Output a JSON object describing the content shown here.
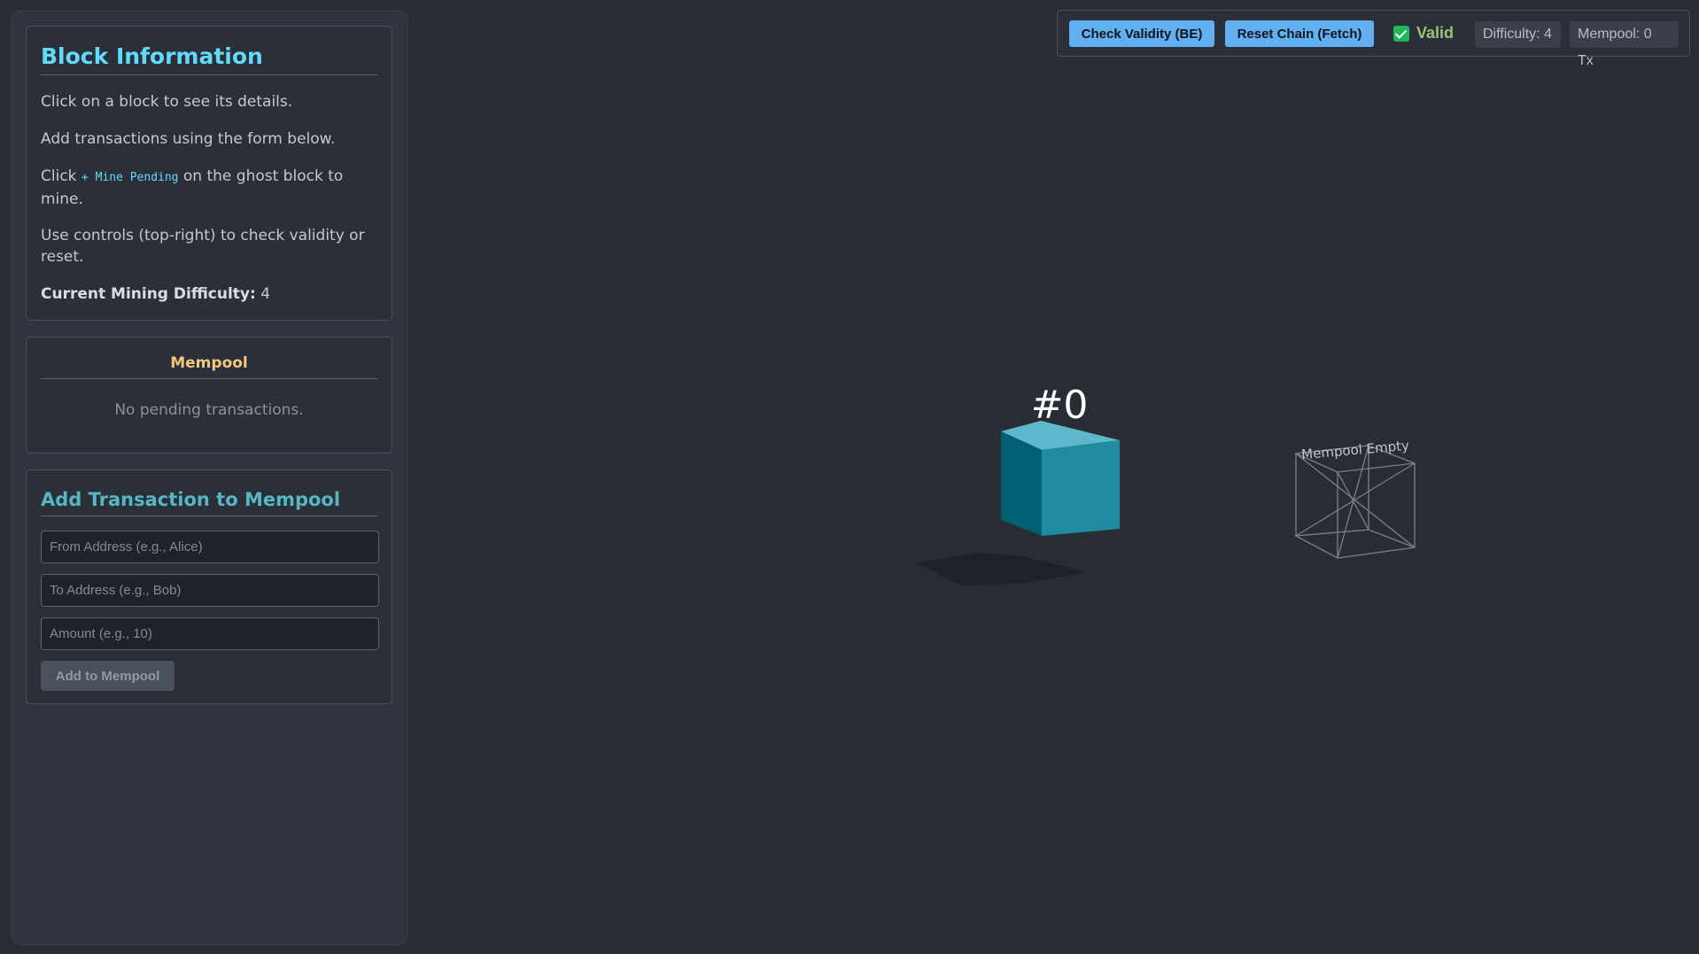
{
  "sidebar": {
    "info": {
      "title": "Block Information",
      "line1": "Click on a block to see its details.",
      "line2": "Add transactions using the form below.",
      "line3_pre": "Click ",
      "line3_code": "+ Mine Pending",
      "line3_post": " on the ghost block to mine.",
      "line4": "Use controls (top-right) to check validity or reset.",
      "difficulty_label": "Current Mining Difficulty:",
      "difficulty_value": " 4"
    },
    "mempool": {
      "title": "Mempool",
      "empty_text": "No pending transactions."
    },
    "add_tx": {
      "title": "Add Transaction to Mempool",
      "from_placeholder": "From Address (e.g., Alice)",
      "to_placeholder": "To Address (e.g., Bob)",
      "amount_placeholder": "Amount (e.g., 10)",
      "from_value": "",
      "to_value": "",
      "amount_value": "",
      "submit_label": "Add to Mempool"
    }
  },
  "controls": {
    "check_label": "Check Validity (BE)",
    "reset_label": "Reset Chain (Fetch)",
    "valid_checked": true,
    "valid_label": "Valid",
    "difficulty_text": "Difficulty: 4",
    "mempool_text": "Mempool: 0 Tx"
  },
  "scene": {
    "block_label": "#0",
    "ghost_label": "Mempool Empty",
    "colors": {
      "block_top": "#5db8cc",
      "block_front": "#218aa1",
      "block_side": "#006073",
      "ghost_edges": "#7a808a",
      "accent": "#61dafb",
      "valid": "#98c379"
    }
  },
  "icons": {
    "valid_checkbox": "checkmark-icon"
  }
}
